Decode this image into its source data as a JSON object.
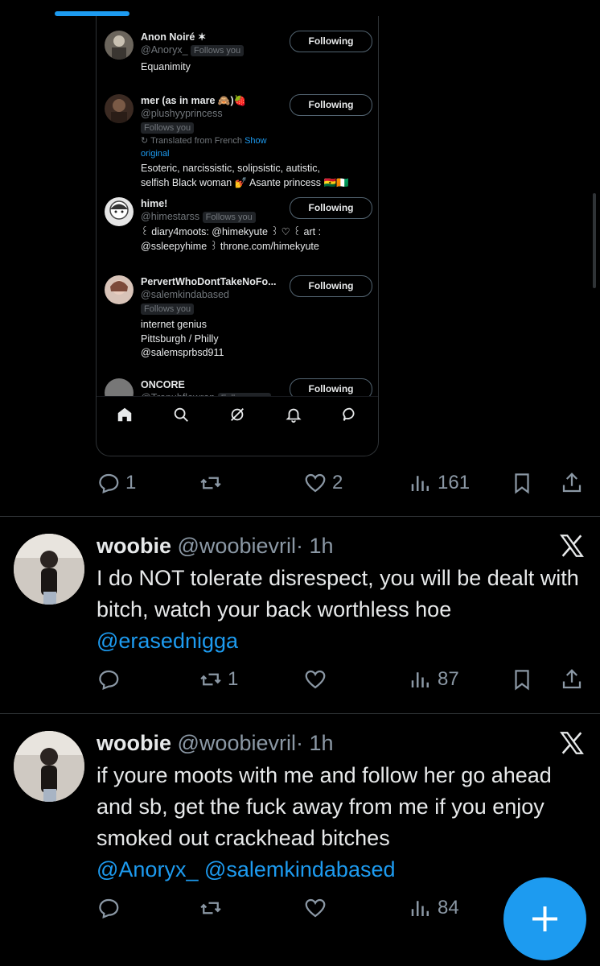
{
  "embedded_card": {
    "users": [
      {
        "name": "Anon Noiré ✶",
        "handle": "@Anoryx_",
        "follows_you": "Follows you",
        "bio_lines": [
          "Equanimity"
        ],
        "button": "Following"
      },
      {
        "name": "mer (as in mare 🙈)🍓",
        "handle": "@plushyyprincess",
        "follows_you": "Follows you",
        "translated": "Translated from French",
        "show_original": "Show original",
        "bio_lines": [
          "Esoteric, narcissistic, solipsistic, autistic,",
          "selfish Black woman 💅 Asante princess 🇬🇭🇨🇮"
        ],
        "button": "Following"
      },
      {
        "name": "hime!",
        "handle": "@himestarss",
        "follows_you": "Follows you",
        "bio_lines": [
          "꒰ diary4moots: @himekyute ꒱ ♡ ꒰ art :",
          "@ssleepyhime ꒱ throne.com/himekyute"
        ],
        "button": "Following"
      },
      {
        "name": "PervertWhoDontTakeNoFo...",
        "handle": "@salemkindabased",
        "follows_you": "Follows you",
        "bio_lines": [
          "internet genius",
          "Pittsburgh / Philly",
          "@salemsprbsd911"
        ],
        "button": "Following"
      },
      {
        "name": "ONCORE",
        "handle": "@Trapuhflowran",
        "follows_you": "Follows you",
        "bio_lines": [],
        "button": "Following"
      }
    ],
    "nav_icons": [
      "home-icon",
      "search-icon",
      "grok-icon",
      "notifications-icon",
      "messages-icon"
    ]
  },
  "post_actions": {
    "replies": "1",
    "reposts": "",
    "likes": "2",
    "views": "161"
  },
  "tweets": [
    {
      "name": "woobie",
      "handle": "@woobievril",
      "time": "· 1h",
      "text": "I do NOT tolerate disrespect, you will be dealt with bitch, watch your back  worthless hoe",
      "mentions": "@erasednigga",
      "replies": "",
      "reposts": "1",
      "likes": "",
      "views": "87"
    },
    {
      "name": "woobie",
      "handle": "@woobievril",
      "time": "· 1h",
      "text": "if youre moots with me and follow her go ahead and sb, get the fuck away from me if you enjoy smoked out crackhead bitches",
      "mentions": "@Anoryx_ @salemkindabased",
      "replies": "",
      "reposts": "",
      "likes": "",
      "views": "84"
    }
  ],
  "fab_label": "+",
  "colors": {
    "accent": "#1d9bf0",
    "background": "#000000",
    "muted": "#8b98a5"
  }
}
